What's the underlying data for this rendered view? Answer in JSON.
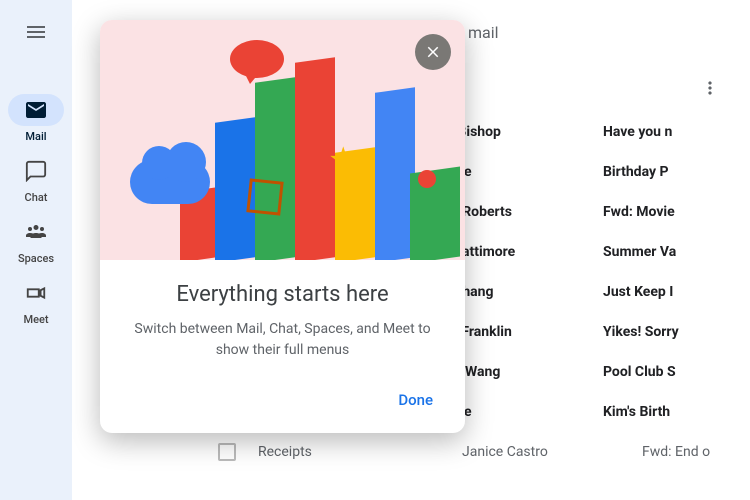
{
  "nav": {
    "items": [
      {
        "label": "Mail"
      },
      {
        "label": "Chat"
      },
      {
        "label": "Spaces"
      },
      {
        "label": "Meet"
      }
    ]
  },
  "search": {
    "hint": "mail"
  },
  "popover": {
    "title": "Everything starts here",
    "desc": "Switch between Mail, Chat, Spaces, and Meet to show their full menus",
    "done": "Done"
  },
  "messages": [
    {
      "sender": "racie Bishop",
      "subject": "Have you n"
    },
    {
      "sender": "ori Cole",
      "subject": "Birthday P"
    },
    {
      "sender": "auren Roberts",
      "subject": "Fwd: Movie"
    },
    {
      "sender": "than Lattimore",
      "subject": "Summer Va"
    },
    {
      "sender": "elen Chang",
      "subject": "Just Keep I"
    },
    {
      "sender": "hirley Franklin",
      "subject": "Yikes! Sorry"
    },
    {
      "sender": "dward Wang",
      "subject": "Pool Club S"
    },
    {
      "sender": "ori Cole",
      "subject": "Kim's Birth"
    }
  ],
  "bottom": {
    "label": "Receipts",
    "sender": "Janice Castro",
    "subject": "Fwd: End o"
  }
}
